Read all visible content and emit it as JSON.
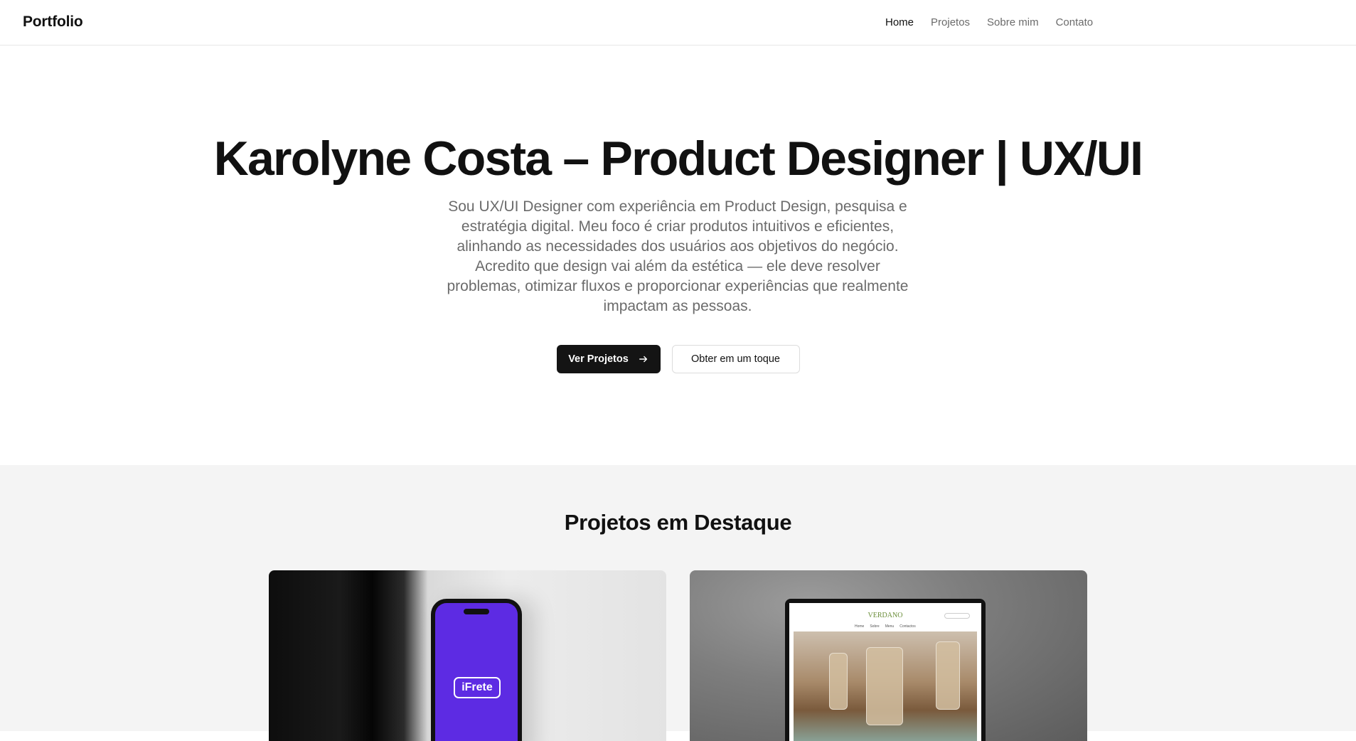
{
  "header": {
    "brand": "Portfolio",
    "nav": [
      {
        "label": "Home",
        "active": true
      },
      {
        "label": "Projetos",
        "active": false
      },
      {
        "label": "Sobre mim",
        "active": false
      },
      {
        "label": "Contato",
        "active": false
      }
    ]
  },
  "hero": {
    "title": "Karolyne Costa – Product Designer | UX/UI",
    "description": "Sou UX/UI Designer com experiência em Product Design, pesquisa e estratégia digital. Meu foco é criar produtos intuitivos e eficientes, alinhando as necessidades dos usuários aos objetivos do negócio. Acredito que design vai além da estética — ele deve resolver problemas, otimizar fluxos e proporcionar experiências que realmente impactam as pessoas.",
    "primary_button": "Ver Projetos",
    "primary_button_icon": "arrow-right-icon",
    "secondary_button": "Obter em um toque"
  },
  "projects": {
    "title": "Projetos em Destaque",
    "cards": [
      {
        "app_logo": "iFrete"
      },
      {
        "site_logo": "VERDANO",
        "site_nav": [
          "Home",
          "Sobre",
          "Menu",
          "Contactos"
        ]
      }
    ]
  },
  "colors": {
    "primary": "#141414",
    "muted_text": "#6b6b6b",
    "section_bg": "#f4f4f4",
    "app_purple": "#5d2be3"
  }
}
